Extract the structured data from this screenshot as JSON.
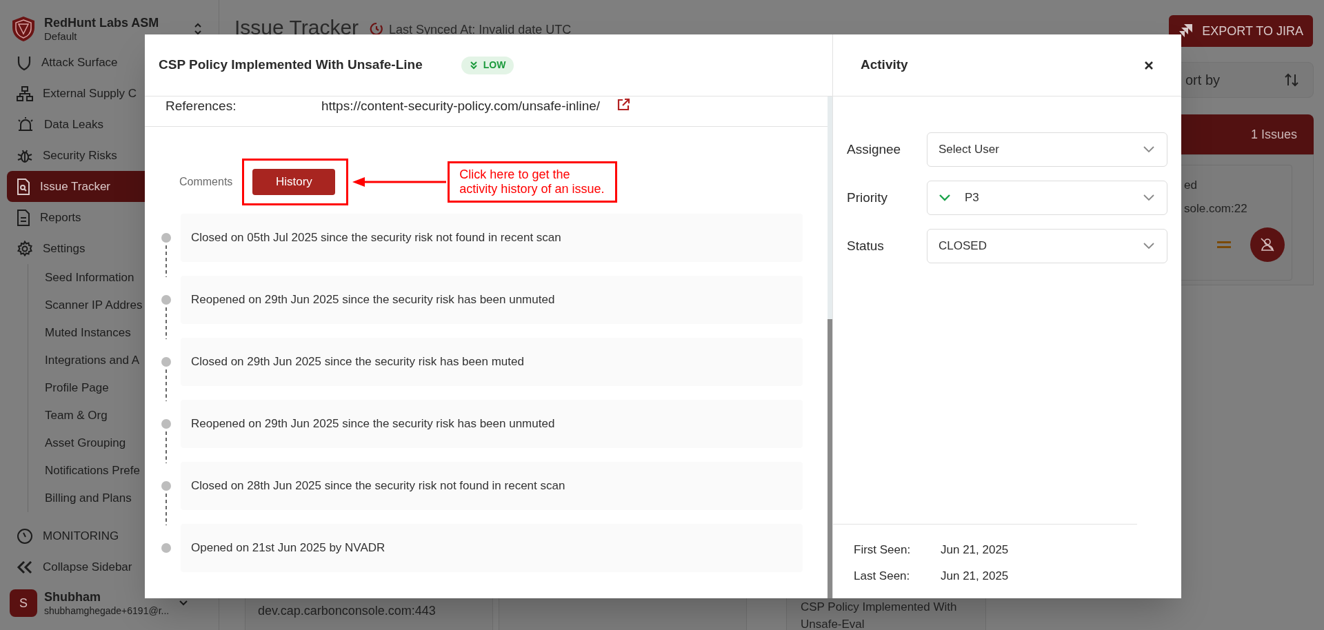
{
  "sidebar": {
    "brand": {
      "name": "RedHunt Labs ASM",
      "workspace": "Default"
    },
    "items": [
      {
        "label": "Attack Surface",
        "selected": false
      },
      {
        "label": "External Supply C",
        "selected": false
      },
      {
        "label": "Data Leaks",
        "selected": false
      },
      {
        "label": "Security Risks",
        "selected": false
      },
      {
        "label": "Issue Tracker",
        "selected": true
      },
      {
        "label": "Reports",
        "selected": false
      },
      {
        "label": "Settings",
        "selected": false,
        "expanded": true,
        "children": [
          {
            "label": "Seed Information"
          },
          {
            "label": "Scanner IP Addres"
          },
          {
            "label": "Muted Instances"
          },
          {
            "label": "Integrations and A"
          },
          {
            "label": "Profile Page"
          },
          {
            "label": "Team & Org"
          },
          {
            "label": "Asset Grouping"
          },
          {
            "label": "Notifications Prefe"
          },
          {
            "label": "Billing and Plans"
          }
        ]
      },
      {
        "label": "MONITORING",
        "selected": false
      },
      {
        "label": "Collapse Sidebar",
        "selected": false
      }
    ],
    "user": {
      "initial": "S",
      "name": "Shubham",
      "email": "shubhamghegade+6191@r..."
    }
  },
  "page": {
    "title": "Issue Tracker",
    "sync": "Last Synced At: Invalid date UTC",
    "export_button": "EXPORT TO JIRA",
    "sort_label": "ort by",
    "issues_count": "1 Issues",
    "card_lines": [
      "ed",
      "sole.com:22"
    ],
    "bottom_host": "dev.cap.carbonconsole.com:443",
    "bottom_title": "CSP Policy Implemented With Unsafe-Eval"
  },
  "modal": {
    "title": "CSP Policy Implemented With Unsafe-Line",
    "severity": "LOW",
    "references_label": "References:",
    "references_url": "https://content-security-policy.com/unsafe-inline/",
    "tabs": [
      {
        "label": "Comments",
        "selected": false
      },
      {
        "label": "History",
        "selected": true
      }
    ],
    "annotation": "Click here to get the activity history of an issue.",
    "history": [
      "Closed on 05th Jul 2025 since the security risk not found in recent scan",
      "Reopened on 29th Jun 2025 since the security risk has been unmuted",
      "Closed on 29th Jun 2025 since the security risk has been muted",
      "Reopened on 29th Jun 2025 since the security risk has been unmuted",
      "Closed on 28th Jun 2025 since the security risk not found in recent scan",
      "Opened on 21st Jun 2025 by NVADR"
    ],
    "activity": {
      "title": "Activity",
      "fields": [
        {
          "label": "Assignee",
          "value": "Select User",
          "kind": "plain"
        },
        {
          "label": "Priority",
          "value": "P3",
          "kind": "priority"
        },
        {
          "label": "Status",
          "value": "CLOSED",
          "kind": "plain"
        }
      ],
      "dates": [
        {
          "label": "First Seen:",
          "value": "Jun 21, 2025"
        },
        {
          "label": "Last Seen:",
          "value": "Jun 21, 2025"
        }
      ]
    }
  }
}
